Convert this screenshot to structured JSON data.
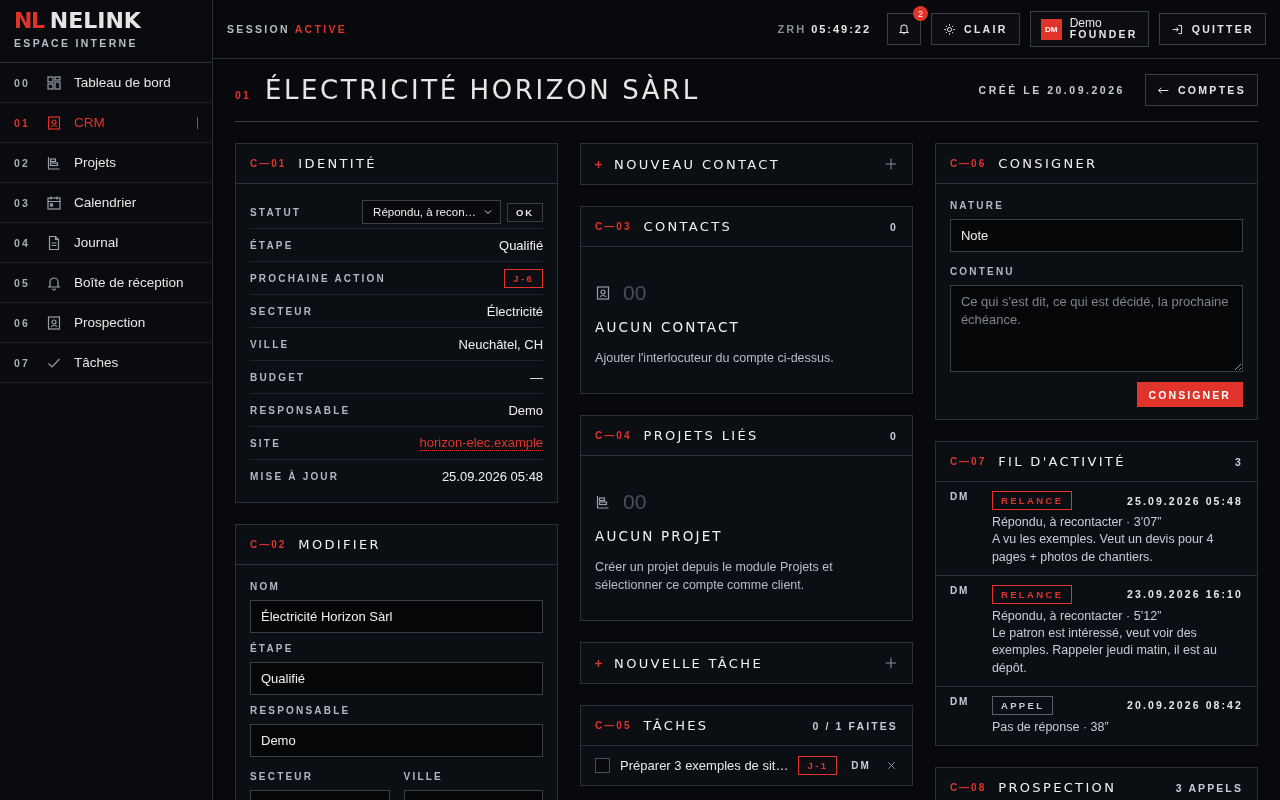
{
  "brand": {
    "mark": "NL",
    "name": "NELINK",
    "subtitle": "ESPACE INTERNE"
  },
  "nav": [
    {
      "number": "00",
      "label": "Tableau de bord",
      "selected": false
    },
    {
      "number": "01",
      "label": "CRM",
      "selected": true
    },
    {
      "number": "02",
      "label": "Projets",
      "selected": false
    },
    {
      "number": "03",
      "label": "Calendrier",
      "selected": false
    },
    {
      "number": "04",
      "label": "Journal",
      "selected": false
    },
    {
      "number": "05",
      "label": "Boîte de réception",
      "selected": false
    },
    {
      "number": "06",
      "label": "Prospection",
      "selected": false
    },
    {
      "number": "07",
      "label": "Tâches",
      "selected": false
    }
  ],
  "topbar": {
    "session_label": "SESSION",
    "session_state": "ACTIVE",
    "zone": "ZRH",
    "time": "05:49:22",
    "notifications": "2",
    "theme_button": "CLAIR",
    "user": {
      "initials": "DM",
      "name": "Demo",
      "role": "FOUNDER"
    },
    "quit_button": "QUITTER"
  },
  "page": {
    "number": "01",
    "title": "ÉLECTRICITÉ HORIZON SÀRL",
    "created": "CRÉÉ LE 20.09.2026",
    "back_button": "COMPTES"
  },
  "identity": {
    "code": "C—01",
    "title": "IDENTITÉ",
    "rows": [
      {
        "label": "STATUT",
        "kind": "select",
        "value": "Répondu, à recon…",
        "button": "OK"
      },
      {
        "label": "ÉTAPE",
        "kind": "text",
        "value": "Qualifié"
      },
      {
        "label": "PROCHAINE ACTION",
        "kind": "badge",
        "value": "J-6"
      },
      {
        "label": "SECTEUR",
        "kind": "text",
        "value": "Électricité"
      },
      {
        "label": "VILLE",
        "kind": "text",
        "value": "Neuchâtel, CH"
      },
      {
        "label": "BUDGET",
        "kind": "text",
        "value": "—"
      },
      {
        "label": "RESPONSABLE",
        "kind": "text",
        "value": "Demo"
      },
      {
        "label": "SITE",
        "kind": "link",
        "value": "horizon-elec.example"
      },
      {
        "label": "MISE À JOUR",
        "kind": "text",
        "value": "25.09.2026 05:48"
      }
    ]
  },
  "edit": {
    "code": "C—02",
    "title": "MODIFIER",
    "fields": [
      {
        "label": "NOM",
        "value": "Électricité Horizon Sàrl"
      },
      {
        "label": "ÉTAPE",
        "value": "Qualifié"
      },
      {
        "label": "RESPONSABLE",
        "value": "Demo"
      }
    ],
    "split_labels": [
      "SECTEUR",
      "VILLE"
    ]
  },
  "new_contact": {
    "label": "NOUVEAU CONTACT"
  },
  "contacts": {
    "code": "C—03",
    "title": "CONTACTS",
    "count": "0",
    "empty_number": "00",
    "empty_title": "AUCUN CONTACT",
    "empty_text": "Ajouter l'interlocuteur du compte ci-dessus."
  },
  "projects": {
    "code": "C—04",
    "title": "PROJETS LIÉS",
    "count": "0",
    "empty_number": "00",
    "empty_title": "AUCUN PROJET",
    "empty_text": "Créer un projet depuis le module Projets et sélectionner ce compte comme client."
  },
  "new_task": {
    "label": "NOUVELLE TÂCHE"
  },
  "tasks": {
    "code": "C—05",
    "title": "TÂCHES",
    "count": "0 / 1 FAITES",
    "items": [
      {
        "text": "Préparer 3 exemples de sit…",
        "due": "J-1",
        "owner": "DM",
        "done": false
      }
    ]
  },
  "log": {
    "code": "C—06",
    "title": "CONSIGNER",
    "nature_label": "NATURE",
    "nature_value": "Note",
    "content_label": "CONTENU",
    "content_placeholder": "Ce qui s'est dit, ce qui est décidé, la prochaine échéance.",
    "submit_button": "CONSIGNER"
  },
  "activity": {
    "code": "C—07",
    "title": "FIL D'ACTIVITÉ",
    "count": "3",
    "entries": [
      {
        "author": "DM",
        "kind": "relance",
        "tag": "RELANCE",
        "date": "25.09.2026 05:48",
        "summary": "Répondu, à recontacter · 3’07”",
        "note": "A vu les exemples. Veut un devis pour 4 pages + photos de chantiers."
      },
      {
        "author": "DM",
        "kind": "relance",
        "tag": "RELANCE",
        "date": "23.09.2026 16:10",
        "summary": "Répondu, à recontacter · 5’12”",
        "note": "Le patron est intéressé, veut voir des exemples. Rappeler jeudi matin, il est au dépôt."
      },
      {
        "author": "DM",
        "kind": "appel",
        "tag": "APPEL",
        "date": "20.09.2026 08:42",
        "summary": "Pas de réponse · 38”"
      }
    ]
  },
  "prospection": {
    "code": "C—08",
    "title": "PROSPECTION",
    "count": "3 APPELS"
  }
}
